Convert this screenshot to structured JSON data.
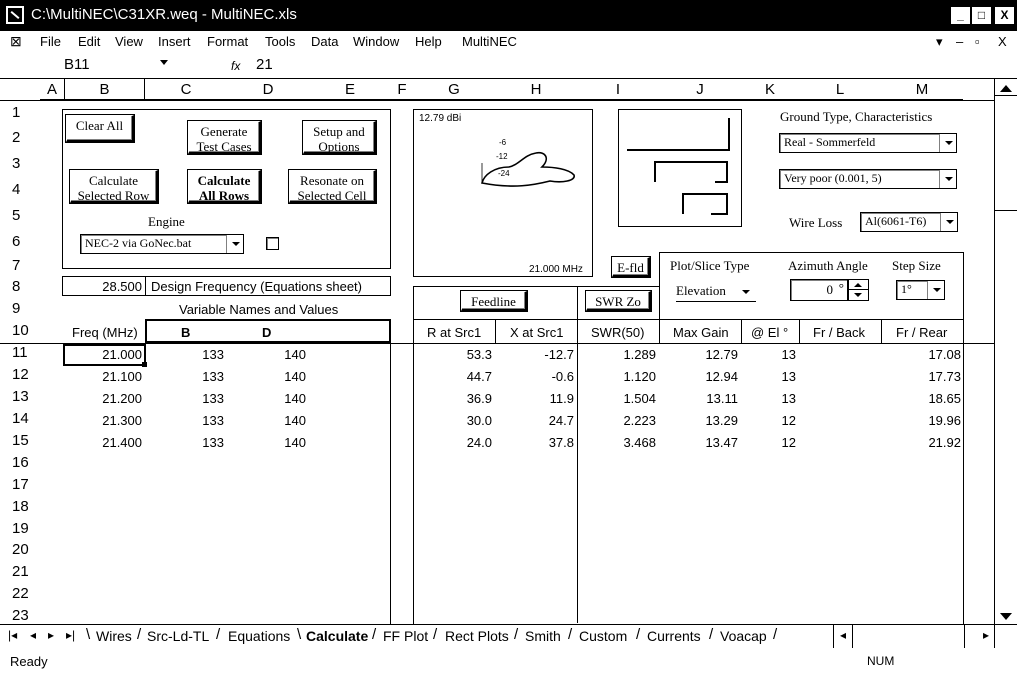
{
  "window": {
    "title": "C:\\MultiNEC\\C31XR.weq - MultiNEC.xls",
    "minimize": "_",
    "maximize": "□",
    "close": "X"
  },
  "menu": {
    "items": [
      "File",
      "Edit",
      "View",
      "Insert",
      "Format",
      "Tools",
      "Data",
      "Window",
      "Help",
      "MultiNEC"
    ],
    "doc_controls": [
      "▾",
      "–",
      "▫",
      "X"
    ]
  },
  "formula": {
    "cell_ref": "B11",
    "fx": "fx",
    "value": "21"
  },
  "columns": [
    "A",
    "B",
    "C",
    "D",
    "E",
    "F",
    "G",
    "H",
    "I",
    "J",
    "K",
    "L",
    "M"
  ],
  "rows": [
    "1",
    "2",
    "3",
    "4",
    "5",
    "6",
    "7",
    "8",
    "9",
    "10",
    "11",
    "12",
    "13",
    "14",
    "15",
    "16",
    "17",
    "18",
    "19",
    "20",
    "21",
    "22",
    "23"
  ],
  "controls": {
    "clear_all": "Clear All",
    "generate": [
      "Generate",
      "Test Cases"
    ],
    "setup": [
      "Setup and",
      "Options"
    ],
    "calculate_selected": [
      "Calculate",
      "Selected Row"
    ],
    "calculate_all": [
      "Calculate",
      "All Rows"
    ],
    "resonate": [
      "Resonate on",
      "Selected Cell"
    ],
    "engine_label": "Engine",
    "engine_value": "NEC-2 via GoNec.bat",
    "design_freq_value": "28.500",
    "design_freq_label": "Design Frequency  (Equations sheet)",
    "var_names_label": "Variable Names and Values",
    "efld": "E-fld",
    "feedline": "Feedline",
    "swr_zo": "SWR Zo",
    "plot_slice_label": "Plot/Slice Type",
    "plot_slice_value": "Elevation",
    "azimuth_label": "Azimuth Angle",
    "azimuth_value": "0",
    "azimuth_unit": "°",
    "step_label": "Step Size",
    "step_value": "1°",
    "ground_label": "Ground Type, Characteristics",
    "ground_type": "Real - Sommerfeld",
    "ground_char": "Very poor (0.001, 5)",
    "wire_loss_label": "Wire Loss",
    "wire_loss_value": "Al(6061-T6)"
  },
  "plot": {
    "gain_label": "12.79 dBi",
    "freq_label": "21.000 MHz",
    "rings": [
      "-6",
      "-12",
      "-24"
    ]
  },
  "table": {
    "headers": [
      "Freq (MHz)",
      "B",
      "D",
      "R at Src1",
      "X at Src1",
      "SWR(50)",
      "Max Gain",
      "@ El °",
      "Fr / Back",
      "Fr / Rear"
    ],
    "rows": [
      [
        "21.000",
        "133",
        "140",
        "53.3",
        "-12.7",
        "1.289",
        "12.79",
        "13",
        "",
        "17.08"
      ],
      [
        "21.100",
        "133",
        "140",
        "44.7",
        "-0.6",
        "1.120",
        "12.94",
        "13",
        "",
        "17.73"
      ],
      [
        "21.200",
        "133",
        "140",
        "36.9",
        "11.9",
        "1.504",
        "13.11",
        "13",
        "",
        "18.65"
      ],
      [
        "21.300",
        "133",
        "140",
        "30.0",
        "24.7",
        "2.223",
        "13.29",
        "12",
        "",
        "19.96"
      ],
      [
        "21.400",
        "133",
        "140",
        "24.0",
        "37.8",
        "3.468",
        "13.47",
        "12",
        "",
        "21.92"
      ]
    ]
  },
  "tabs": [
    "Wires",
    "Src-Ld-TL",
    "Equations",
    "Calculate",
    "FF Plot",
    "Rect Plots",
    "Smith",
    "Custom",
    "Currents",
    "Voacap"
  ],
  "tab_nav": [
    "|◂",
    "◂",
    "▸",
    "▸|"
  ],
  "status": {
    "left": "Ready",
    "right": "NUM"
  }
}
